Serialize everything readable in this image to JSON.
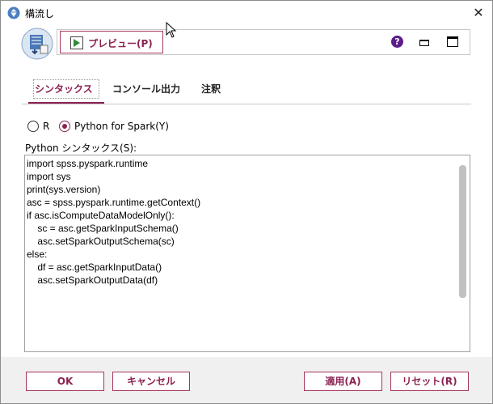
{
  "window": {
    "title": "構流し",
    "close_glyph": "✕"
  },
  "toolbar": {
    "preview_label": "プレビュー(P)",
    "help_glyph": "?"
  },
  "tabs": [
    {
      "label": "シンタックス",
      "active": true
    },
    {
      "label": "コンソール出力",
      "active": false
    },
    {
      "label": "注釈",
      "active": false
    }
  ],
  "language": {
    "options": [
      {
        "label": "R",
        "selected": false
      },
      {
        "label": "Python for Spark(Y)",
        "selected": true
      }
    ]
  },
  "editor": {
    "label": "Python シンタックス(S):",
    "code": "import spss.pyspark.runtime\nimport sys\nprint(sys.version)\nasc = spss.pyspark.runtime.getContext()\nif asc.isComputeDataModelOnly():\n    sc = asc.getSparkInputSchema()\n    asc.setSparkOutputSchema(sc)\nelse:\n    df = asc.getSparkInputData()\n    asc.setSparkOutputData(df)"
  },
  "buttons": {
    "ok": "OK",
    "cancel": "キャンセル",
    "apply": "適用(A)",
    "reset": "リセット(R)"
  },
  "colors": {
    "accent": "#8b2252",
    "button_border": "#a6385e",
    "help_icon": "#5b1e8a",
    "footer_bg": "#f0f0f0"
  }
}
